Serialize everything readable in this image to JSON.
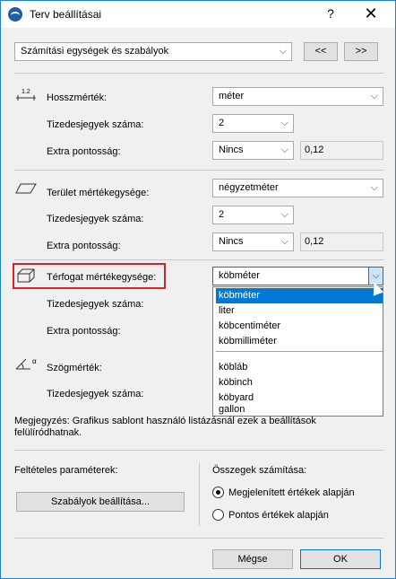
{
  "window": {
    "title": "Terv beállításai",
    "help": "?",
    "close": "✕"
  },
  "top": {
    "category": "Számítási egységek és szabályok",
    "prev": "<<",
    "next": ">>"
  },
  "length": {
    "unit_label": "Hosszmérték:",
    "unit": "méter",
    "icon_text": "1.2",
    "decimals_label": "Tizedesjegyek száma:",
    "decimals": "2",
    "extra_label": "Extra pontosság:",
    "extra": "Nincs",
    "extra_value": "0,12"
  },
  "area": {
    "unit_label": "Terület mértékegysége:",
    "unit": "négyzetméter",
    "decimals_label": "Tizedesjegyek száma:",
    "decimals": "2",
    "extra_label": "Extra pontosság:",
    "extra": "Nincs",
    "extra_value": "0,12"
  },
  "volume": {
    "unit_label": "Térfogat mértékegysége:",
    "unit": "köbméter",
    "decimals_label": "Tizedesjegyek száma:",
    "extra_label": "Extra pontosság:",
    "options": [
      "köbméter",
      "liter",
      "köbcentiméter",
      "köbmilliméter",
      "köbláb",
      "köbinch",
      "köbyard",
      "gallon"
    ]
  },
  "angle": {
    "unit_label": "Szögmérték:",
    "decimals_label": "Tizedesjegyek száma:",
    "icon_text": "α"
  },
  "note": "Megjegyzés: Grafikus sablont használó listázásnál ezek a beállítások felülíródhatnak.",
  "conditional": {
    "label": "Feltételes paraméterek:",
    "button": "Szabályok beállítása..."
  },
  "sums": {
    "label": "Összegek számítása:",
    "opt1": "Megjelenített értékek alapján",
    "opt2": "Pontos értékek alapján",
    "selected": 1
  },
  "footer": {
    "cancel": "Mégse",
    "ok": "OK"
  },
  "colors": {
    "accent": "#0078d7",
    "highlight_box": "#e02020",
    "border": "#1883d7"
  }
}
